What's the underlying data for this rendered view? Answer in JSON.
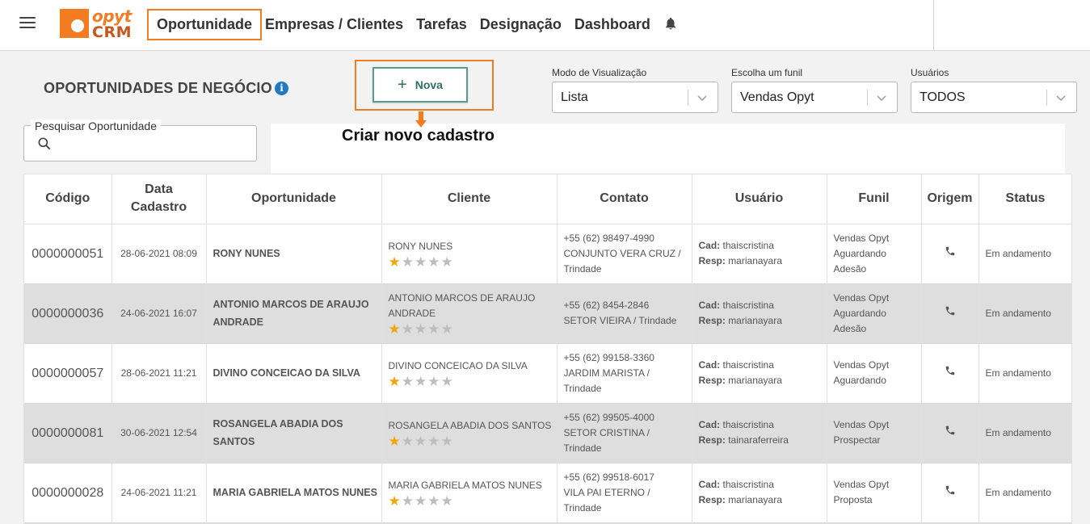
{
  "nav": {
    "items": [
      "Oportunidade",
      "Empresas / Clientes",
      "Tarefas",
      "Designação",
      "Dashboard"
    ],
    "active": "Oportunidade"
  },
  "logo": {
    "text_top": "opyt",
    "text_bottom": "CRM"
  },
  "page": {
    "title": "OPORTUNIDADES DE NEGÓCIO",
    "new_button": "Nova",
    "annotation": "Criar novo cadastro"
  },
  "filters": {
    "view_mode": {
      "label": "Modo de Visualização",
      "value": "Lista"
    },
    "funnel": {
      "label": "Escolha um funil",
      "value": "Vendas Opyt"
    },
    "users": {
      "label": "Usuários",
      "value": "TODOS"
    }
  },
  "search": {
    "label": "Pesquisar Oportunidade",
    "value": ""
  },
  "table": {
    "headers": {
      "codigo": "Código",
      "data_l1": "Data",
      "data_l2": "Cadastro",
      "oportunidade": "Oportunidade",
      "cliente": "Cliente",
      "contato": "Contato",
      "usuario": "Usuário",
      "funil": "Funil",
      "origem": "Origem",
      "status": "Status"
    },
    "cad_label": "Cad:",
    "resp_label": "Resp:",
    "rows": [
      {
        "code": "0000000051",
        "date": "28-06-2021 08:09",
        "opportunity": "RONY NUNES",
        "client_l1": "RONY NUNES",
        "client_l2": "",
        "rating": 1,
        "phone": "+55 (62) 98497-4990",
        "addr_l1": "CONJUNTO VERA CRUZ /",
        "addr_l2": "Trindade",
        "cad": "thaiscristina",
        "resp": "marianayara",
        "funnel_l1": "Vendas Opyt",
        "funnel_l2": "Aguardando",
        "funnel_l3": "Adesão",
        "origin_icon": "phone-icon",
        "status": "Em andamento"
      },
      {
        "code": "0000000036",
        "date": "24-06-2021 16:07",
        "opportunity": "ANTONIO MARCOS DE ARAUJO ANDRADE",
        "client_l1": "ANTONIO MARCOS DE ARAUJO",
        "client_l2": "ANDRADE",
        "rating": 1,
        "phone": "+55 (62) 8454-2846",
        "addr_l1": "SETOR VIEIRA / Trindade",
        "addr_l2": "",
        "cad": "thaiscristina",
        "resp": "marianayara",
        "funnel_l1": "Vendas Opyt",
        "funnel_l2": "Aguardando",
        "funnel_l3": "Adesão",
        "origin_icon": "phone-icon",
        "status": "Em andamento"
      },
      {
        "code": "0000000057",
        "date": "28-06-2021 11:21",
        "opportunity": "DIVINO CONCEICAO DA SILVA",
        "client_l1": "DIVINO CONCEICAO DA SILVA",
        "client_l2": "",
        "rating": 1,
        "phone": "+55 (62) 99158-3360",
        "addr_l1": "JARDIM MARISTA /",
        "addr_l2": "Trindade",
        "cad": "thaiscristina",
        "resp": "marianayara",
        "funnel_l1": "Vendas Opyt",
        "funnel_l2": "Aguardando",
        "funnel_l3": "",
        "origin_icon": "phone-icon",
        "status": "Em andamento"
      },
      {
        "code": "0000000081",
        "date": "30-06-2021 12:54",
        "opportunity": "ROSANGELA ABADIA DOS SANTOS",
        "client_l1": "ROSANGELA ABADIA DOS SANTOS",
        "client_l2": "",
        "rating": 1,
        "phone": "+55 (62) 99505-4000",
        "addr_l1": "SETOR CRISTINA /",
        "addr_l2": "Trindade",
        "cad": "thaiscristina",
        "resp": "tainaraferreira",
        "funnel_l1": "Vendas Opyt",
        "funnel_l2": "Prospectar",
        "funnel_l3": "",
        "origin_icon": "phone-icon",
        "status": "Em andamento"
      },
      {
        "code": "0000000028",
        "date": "24-06-2021 11:21",
        "opportunity": "MARIA GABRIELA MATOS NUNES",
        "client_l1": "MARIA GABRIELA MATOS NUNES",
        "client_l2": "",
        "rating": 1,
        "phone": "+55 (62) 99518-6017",
        "addr_l1": "VILA PAI ETERNO /",
        "addr_l2": "Trindade",
        "cad": "thaiscristina",
        "resp": "marianayara",
        "funnel_l1": "Vendas Opyt",
        "funnel_l2": "Proposta",
        "funnel_l3": "",
        "origin_icon": "phone-icon",
        "status": "Em andamento"
      }
    ]
  },
  "colors": {
    "accent": "#f47c20",
    "button_border": "#5a9a94",
    "info": "#1f7ac2",
    "star_on": "#f2a60c",
    "star_off": "#bdbdbd"
  }
}
